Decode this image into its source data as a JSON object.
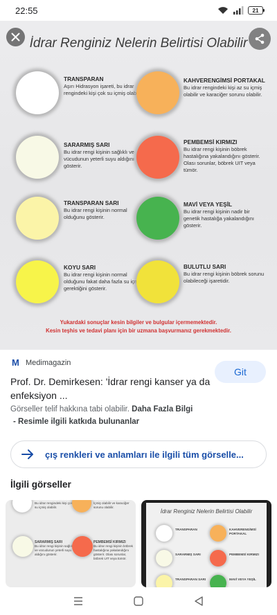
{
  "status": {
    "time": "22:55",
    "battery": "21"
  },
  "hero": {
    "title": "İdrar Renginiz Nelerin Belirtisi Olabilir",
    "left_items": [
      {
        "title": "TRANSPARAN",
        "text": "Aşırı Hidrasyon işareti, bu idrar rengindeki kişi çok su içmiş olabilir.",
        "color": "#ffffff"
      },
      {
        "title": "SARARMIŞ SARI",
        "text": "Bu idrar rengi kişinin sağlıklı ve vücudunun yeterli suyu aldığını gösterir.",
        "color": "#f8f9e6"
      },
      {
        "title": "TRANSPARAN SARI",
        "text": "Bu idrar rengi kişinin normal olduğunu gösterir.",
        "color": "#fbf4a8"
      },
      {
        "title": "KOYU SARI",
        "text": "Bu idrar rengi kişinin normal olduğunu fakat daha fazla su içmesi gerektiğini gösterir.",
        "color": "#f7f44a"
      }
    ],
    "right_items": [
      {
        "title": "KAHVERENGİMSİ PORTAKAL",
        "text": "Bu idrar rengindeki kişi az su içmiş olabilir ve karaciğer sorunu olabilir.",
        "color": "#f7b15a"
      },
      {
        "title": "PEMBEMSİ KIRMIZI",
        "text": "Bu idrar rengi kişinin böbrek hastalığına yakalandığını gösterir. Olası sorunlar, böbrek UIT veya tümör.",
        "color": "#f56a4c"
      },
      {
        "title": "MAVİ VEYA YEŞİL",
        "text": "Bu idrar rengi kişinin nadir bir genetik hastalığa yakalandığını gösterir.",
        "color": "#47b34f"
      },
      {
        "title": "BULUTLU SARI",
        "text": "Bu idrar rengi kişinin böbrek sorunu olabileceği işaretidir.",
        "color": "#f1e23a"
      }
    ],
    "disclaimer_1": "Yukardaki sonuçlar kesin bilgiler ve bulgular içermemektedir.",
    "disclaimer_2": "Kesin teşhis ve tedavi planı için bir uzmana başvurmanız gerekmektedir."
  },
  "source": {
    "logo": "M",
    "name": "Medimagazin",
    "go_label": "Git",
    "title": "Prof. Dr. Demirkesen: 'İdrar rengi kanser ya da enfeksiyon ...",
    "copyright": "Görseller telif hakkına tabi olabilir.",
    "more_info": "Daha Fazla Bilgi",
    "related_link": "Resimle ilgili katkıda bulunanlar"
  },
  "search_pill": {
    "text": "çış renkleri ve anlamları ile ilgili tüm görselle..."
  },
  "related": {
    "heading": "İlgili görseller",
    "thumb1": {
      "top_text": "Bu idrar rengindeki kişi çok su içmiş olabilir.",
      "top_right_text": "İçmiş olabilir ve karaciğer sorunu olabilir.",
      "item1_title": "SARARMIŞ SARI",
      "item1_text": "Bu idrar rengi kişinin sağlıklı ve vücudunun yeterli suyu aldığını gösterir.",
      "item2_title": "PEMBEMSİ KIRMIZI",
      "item2_text": "Bu idrar rengi kişinin böbrek hastalığına yakalandığını gösterir. Olası sorunlar, böbrek UIT veya tümör."
    },
    "thumb2": {
      "title": "İdrar Renginiz Nelerin Belirtisi Olabilir",
      "items": [
        "TRANSPARAN",
        "KAHVERENGİMSİ PORTAKAL",
        "SARARMIŞ SARI",
        "PEMBEMSİ KIRMIZI",
        "TRANSPARAN SARI",
        "MAVİ VEYA YEŞİL"
      ]
    }
  }
}
